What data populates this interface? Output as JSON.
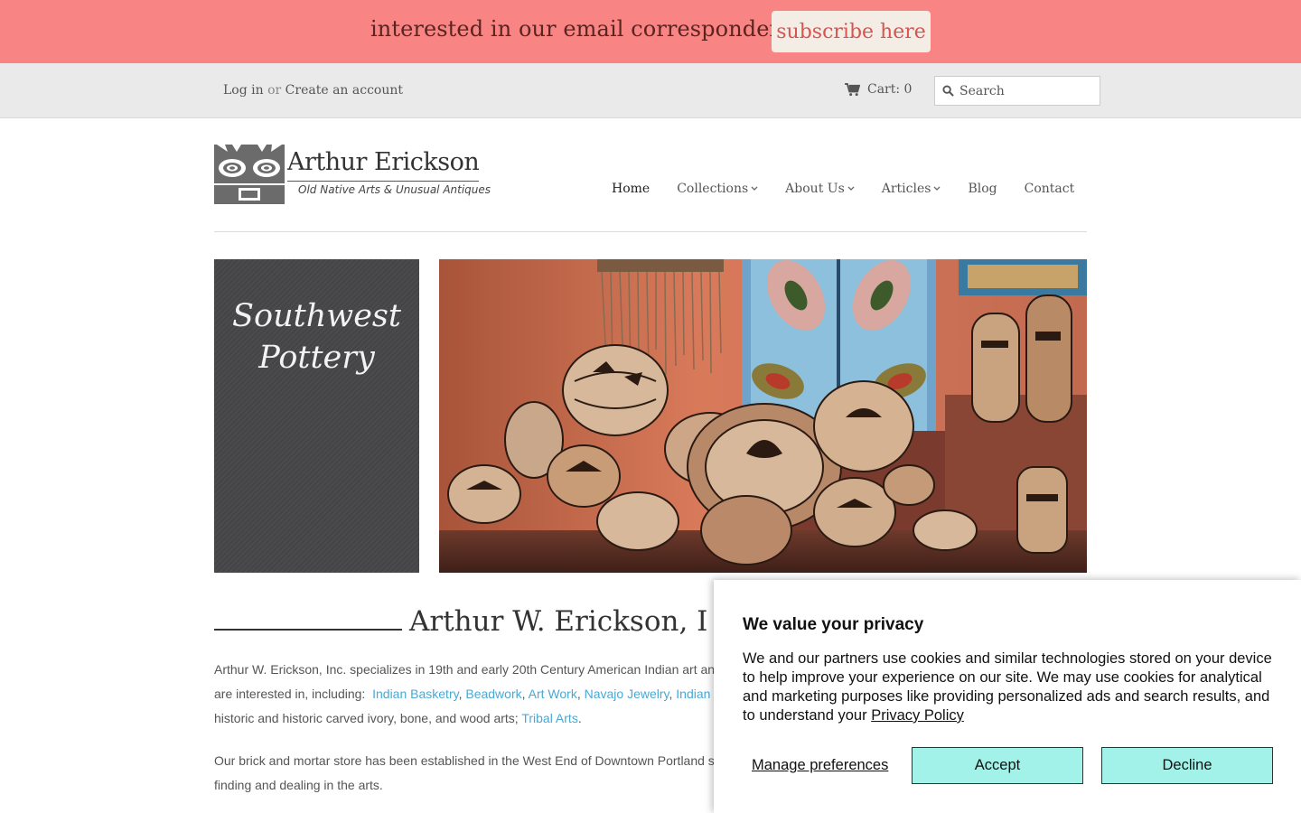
{
  "promo": {
    "text": "interested in our email correspondence?",
    "button_label": "subscribe here"
  },
  "account": {
    "login_label": "Log in",
    "or_label": "or",
    "create_label": "Create an account"
  },
  "cart": {
    "label": "Cart: 0",
    "icon": "cart-icon"
  },
  "search": {
    "placeholder": "Search",
    "icon": "search-icon"
  },
  "logo": {
    "name": "Arthur Erickson",
    "tagline": "Old Native Arts & Unusual Antiques"
  },
  "nav": {
    "items": [
      {
        "label": "Home",
        "active": true,
        "dropdown": false
      },
      {
        "label": "Collections",
        "dropdown": true
      },
      {
        "label": "About Us",
        "dropdown": true
      },
      {
        "label": "Articles",
        "dropdown": true
      },
      {
        "label": "Blog",
        "dropdown": false
      },
      {
        "label": "Contact",
        "dropdown": false
      }
    ]
  },
  "hero": {
    "panel_title_line1": "Southwest",
    "panel_title_line2": "Pottery"
  },
  "main": {
    "heading": "Arthur W. Erickson, I",
    "p1_line1": "Arthur W. Erickson, Inc. specializes in 19th and early 20th Century American Indian art an",
    "p1_line2_prefix": "are interested in, including:",
    "links": [
      "Indian Basketry",
      "Beadwork",
      "Art Work",
      "Navajo Jewelry",
      "Indian"
    ],
    "p1_line3_prefix": "historic and historic carved ivory, bone, and wood arts;",
    "p1_line3_link": "Tribal Arts",
    "p2_line1": "Our brick and mortar store has been established in the West End of Downtown Portland s",
    "p2_line2": "finding and dealing in the arts."
  },
  "cookie": {
    "title": "We value your privacy",
    "body": "We and our partners use cookies and similar technologies stored on your device to help improve your experience on our site. We may use cookies for analytical and marketing purposes like providing personalized ads and search results, and to understand your",
    "policy_link": "Privacy Policy",
    "manage_label": "Manage preferences",
    "accept_label": "Accept",
    "decline_label": "Decline"
  },
  "colors": {
    "promo_bg": "#f88483",
    "accent_button": "#a3f2ea",
    "link": "#49a9d4"
  }
}
